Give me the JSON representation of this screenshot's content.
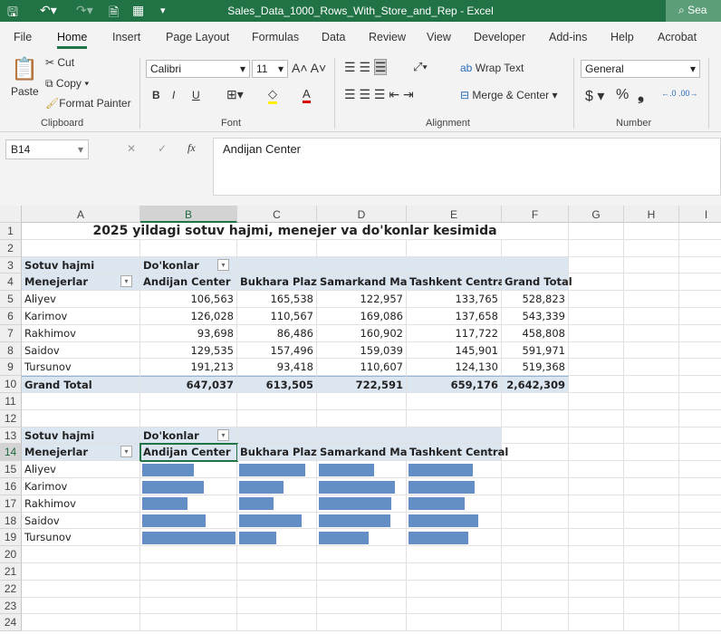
{
  "window": {
    "title": "Sales_Data_1000_Rows_With_Store_and_Rep  -  Excel",
    "search": "Sea"
  },
  "menu_tabs": [
    "File",
    "Home",
    "Insert",
    "Page Layout",
    "Formulas",
    "Data",
    "Review",
    "View",
    "Developer",
    "Add-ins",
    "Help",
    "Acrobat"
  ],
  "ribbon": {
    "clipboard": {
      "paste": "Paste",
      "cut": "Cut",
      "copy": "Copy",
      "format_painter": "Format Painter",
      "label": "Clipboard"
    },
    "font": {
      "name": "Calibri",
      "size": "11",
      "label": "Font",
      "bold": "B",
      "italic": "I",
      "underline": "U"
    },
    "alignment": {
      "wrap": "Wrap Text",
      "merge": "Merge & Center",
      "label": "Alignment"
    },
    "number": {
      "format": "General",
      "label": "Number",
      "currency": "$",
      "percent": "%",
      "comma": "❟"
    }
  },
  "formula_bar": {
    "name_box": "B14",
    "content": "Andijan Center",
    "fx": "fx"
  },
  "columns": [
    "A",
    "B",
    "C",
    "D",
    "E",
    "F",
    "G",
    "H",
    "I"
  ],
  "sheet": {
    "title": "2025 yildagi sotuv hajmi, menejer va do'konlar kesimida",
    "pivot1": {
      "values_label": "Sotuv hajmi",
      "columns_label": "Do'konlar",
      "rows_label": "Menejerlar",
      "stores": [
        "Andijan Center",
        "Bukhara Plaza",
        "Samarkand Mall",
        "Tashkent Central",
        "Grand Total"
      ],
      "rows": [
        {
          "name": "Aliyev",
          "values": [
            "106,563",
            "165,538",
            "122,957",
            "133,765",
            "528,823"
          ]
        },
        {
          "name": "Karimov",
          "values": [
            "126,028",
            "110,567",
            "169,086",
            "137,658",
            "543,339"
          ]
        },
        {
          "name": "Rakhimov",
          "values": [
            "93,698",
            "86,486",
            "160,902",
            "117,722",
            "458,808"
          ]
        },
        {
          "name": "Saidov",
          "values": [
            "129,535",
            "157,496",
            "159,039",
            "145,901",
            "591,971"
          ]
        },
        {
          "name": "Tursunov",
          "values": [
            "191,213",
            "93,418",
            "110,607",
            "124,130",
            "519,368"
          ]
        }
      ],
      "total": {
        "name": "Grand Total",
        "values": [
          "647,037",
          "613,505",
          "722,591",
          "659,176",
          "2,642,309"
        ]
      }
    },
    "pivot2": {
      "values_label": "Sotuv hajmi",
      "columns_label": "Do'konlar",
      "rows_label": "Menejerlar",
      "stores": [
        "Andijan Center",
        "Bukhara Plaza",
        "Samarkand Mall",
        "Tashkent Central"
      ],
      "rows": [
        {
          "name": "Aliyev",
          "values": [
            106563,
            165538,
            122957,
            133765
          ]
        },
        {
          "name": "Karimov",
          "values": [
            126028,
            110567,
            169086,
            137658
          ]
        },
        {
          "name": "Rakhimov",
          "values": [
            93698,
            86486,
            160902,
            117722
          ]
        },
        {
          "name": "Saidov",
          "values": [
            129535,
            157496,
            159039,
            145901
          ]
        },
        {
          "name": "Tursunov",
          "values": [
            191213,
            93418,
            110607,
            124130
          ]
        }
      ],
      "bar_color": "#638ec6"
    }
  }
}
